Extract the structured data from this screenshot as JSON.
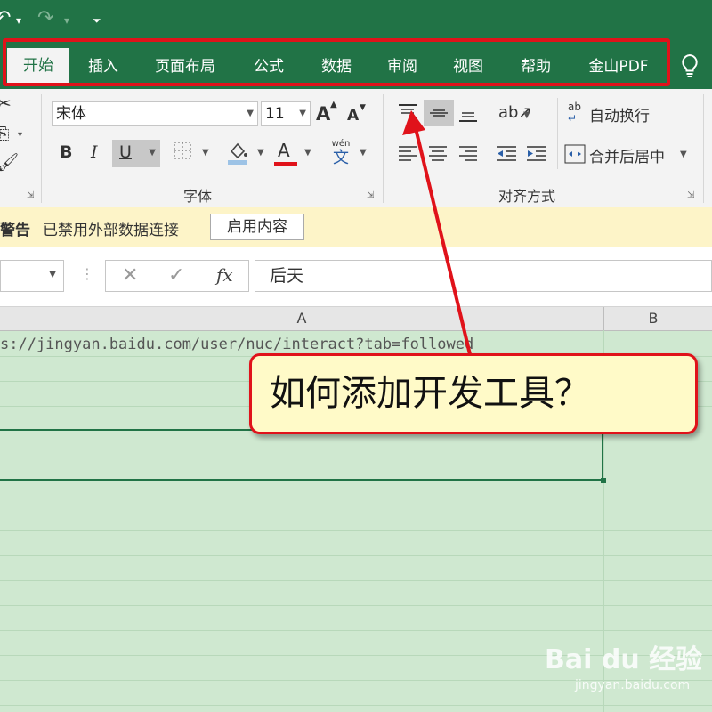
{
  "quick_access": {
    "undo_glyph": "↶",
    "redo_glyph": "↷",
    "customize_glyph": "⏷"
  },
  "tabs": [
    {
      "label": "开始",
      "active": true
    },
    {
      "label": "插入"
    },
    {
      "label": "页面布局"
    },
    {
      "label": "公式"
    },
    {
      "label": "数据"
    },
    {
      "label": "审阅"
    },
    {
      "label": "视图"
    },
    {
      "label": "帮助"
    },
    {
      "label": "金山PDF"
    }
  ],
  "font_group": {
    "font_name": "宋体",
    "font_size": "11",
    "grow_label": "A",
    "shrink_label": "A",
    "bold": "B",
    "italic": "I",
    "underline": "U",
    "font_color_label": "A",
    "phonetic_top": "wén",
    "phonetic_bottom": "文",
    "label": "字体"
  },
  "align_group": {
    "wrap_label": "自动换行",
    "merge_label": "合并后居中",
    "wrap_icon_text": "ab",
    "label": "对齐方式"
  },
  "security_bar": {
    "title": "警告",
    "message": "已禁用外部数据连接",
    "button": "启用内容"
  },
  "formula_bar": {
    "fx": "fx",
    "cancel": "✕",
    "enter": "✓",
    "value": "后天"
  },
  "columns": [
    "A",
    "B"
  ],
  "cells": {
    "url_text": "s://jingyan.baidu.com/user/nuc/interact?tab=followed"
  },
  "annotation": {
    "text": "如何添加开发工具？"
  },
  "watermark": {
    "brand": "Bai du 经验",
    "url": "jingyan.baidu.com"
  },
  "colors": {
    "excel_green": "#217346",
    "highlight_red": "#e0121a",
    "sheet_bg": "#cfe8d0"
  }
}
